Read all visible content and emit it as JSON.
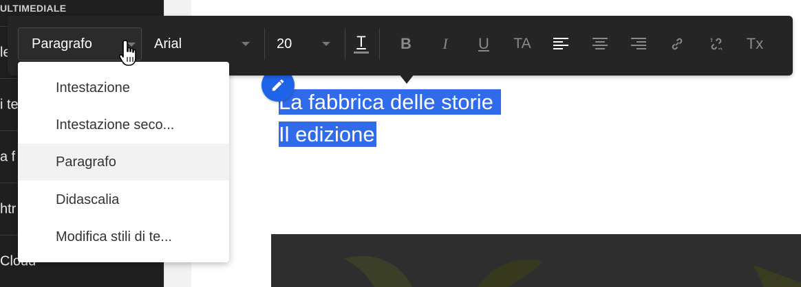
{
  "sidebar": {
    "section_title": "ULTIMEDIALE",
    "items": [
      {
        "label": "le"
      },
      {
        "label": "i te"
      },
      {
        "label": "a f"
      },
      {
        "label": "htr"
      },
      {
        "label": "Cloud"
      }
    ]
  },
  "toolbar": {
    "paragraph_style": "Paragrafo",
    "font_family": "Arial",
    "font_size": "20",
    "text_color_glyph": "T",
    "bold_glyph": "B",
    "italic_glyph": "I",
    "underline_glyph": "U",
    "text_case_glyph": "TA",
    "clear_format_glyph": "Tx",
    "icons": [
      "text-color-icon",
      "bold-icon",
      "italic-icon",
      "underline-icon",
      "text-case-icon",
      "align-left-icon",
      "align-center-icon",
      "align-right-icon",
      "link-icon",
      "unlink-icon",
      "clear-format-icon"
    ]
  },
  "style_menu": {
    "items": [
      {
        "label": "Intestazione",
        "active": false
      },
      {
        "label": "Intestazione seco...",
        "active": false
      },
      {
        "label": "Paragrafo",
        "active": true
      },
      {
        "label": "Didascalia",
        "active": false
      },
      {
        "label": "Modifica stili di te...",
        "active": false
      }
    ]
  },
  "canvas": {
    "selected_lines": [
      "La fabbrica delle storie ",
      "Il edizione"
    ]
  },
  "colors": {
    "selection": "#2f6bea",
    "edit_button": "#1f64e8",
    "toolbar_bg": "#252525"
  }
}
